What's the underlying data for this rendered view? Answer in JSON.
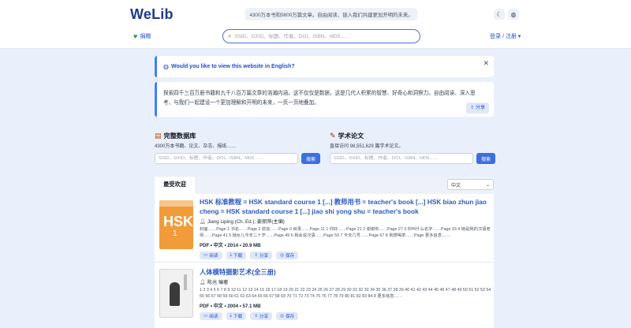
{
  "header": {
    "logo": "WeLib",
    "tagline": "4300万本书和9800万篇文章。自由阅读、链入我们共建更加开明的未来。",
    "donate_label": "捐赠",
    "search_placeholder": "SSID、DXID、标题、作者、DOI、ISBN、MD5……",
    "login_label": "登录 / 注册"
  },
  "english_banner": {
    "text": "Would you like to view this website in English?"
  },
  "intro": {
    "text": "探索四千三百万册书籍和九千八百万篇文章的浩瀚内涵。这不仅仅是数据，这是几代人积累的智慧、好奇心和洞察力。自由阅读、深入思考，与我们一起建设一个更加理解和开明的未来，一页一页地叠加。",
    "share_label": "分享"
  },
  "databases": [
    {
      "title": "完整数据库",
      "subtitle": "4300万本书籍、论文、杂志、报纸……",
      "placeholder": "SSID、DXID、标题、作者、DOI、ISBN、MD5……",
      "button": "搜索"
    },
    {
      "title": "学术论文",
      "subtitle": "直接访问 98,551,629 篇学术论文。",
      "placeholder": "SSID、DXID、标题、作者、DOI、ISBN、MD5……",
      "button": "搜索"
    }
  ],
  "results": {
    "tab_label": "最受欢迎",
    "sort_label": "中文",
    "books": [
      {
        "title": "HSK 标准教程 = HSK standard course 1 [...] 教师用书 = teacher's book [...] HSK biao zhun jiao cheng = HSK standard course 1 [...] jiao shi yong shu = teacher's book",
        "author": "Jiang Liping (Ch. Ed.); 姜丽萍(主编)",
        "description": "封面……Page 1 书名……Page 2 前言……Page 0 目录……Page 11 1 你好……Page 21 2 谢谢你……Page 27 3 你叫什么名字……Page 33 4 她是我的汉语老师……Page 41 5 她女儿今年二十岁……Page 49 6 我会说汉语……Page 59 7 今天几号……Page 67 8 我想喝茶……Page 更多信息……",
        "meta": "PDF • 中文 • 2014 • 20.9 MB",
        "cover_text": "HSK",
        "cover_num": "1"
      },
      {
        "title": "人体模特摄影艺术(全三册)",
        "author": "陈光 编著",
        "description": "1 2 3 4 5 6 7 8 9 10 11 12 13 14 15 16 17 18 19 20 21 22 23 24 25 26 27 28 29 30 31 32 33 34 35 36 37 38 39 40 41 42 43 44 45 46 47 48 49 50 51 52 53 54 55 56 57 58 59 60 61 62 63 64 65 66 67 68 69 70 71 72 73 74 75 76 77 78 79 80 81 82 83 84 8 更多信息……",
        "meta": "PDF • 中文 • 2004 • 57.1 MB"
      }
    ],
    "actions": [
      "阅读",
      "下载",
      "分享",
      "保存"
    ]
  }
}
